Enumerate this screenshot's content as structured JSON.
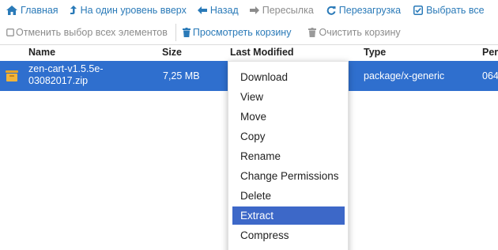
{
  "toolbar": {
    "home": "Главная",
    "up": "На один уровень вверх",
    "back": "Назад",
    "forward": "Пересылка",
    "reload": "Перезагрузка",
    "select_all": "Выбрать все",
    "deselect_all": "Отменить выбор всех элементов",
    "view_trash": "Просмотреть корзину",
    "empty_trash": "Очистить корзину"
  },
  "table": {
    "columns": [
      "Name",
      "Size",
      "Last Modified",
      "Type",
      "Per"
    ],
    "rows": [
      {
        "name_line1": "zen-cart-v1.5.5e-",
        "name_line2": "03082017.zip",
        "size": "7,25 MB",
        "type": "package/x-generic",
        "perms": "064"
      }
    ]
  },
  "context_menu": {
    "items": [
      "Download",
      "View",
      "Move",
      "Copy",
      "Rename",
      "Change Permissions",
      "Delete",
      "Extract",
      "Compress"
    ],
    "highlighted": "Extract"
  },
  "colors": {
    "link": "#2a7ab8",
    "selected_row": "#2f6fce",
    "menu_highlight": "#3d68c8",
    "archive_icon": "#e8a624"
  },
  "icons": [
    "home-icon",
    "level-up-icon",
    "arrow-left-icon",
    "arrow-right-icon",
    "refresh-icon",
    "checkbox-checked-icon",
    "checkbox-empty-icon",
    "trash-icon",
    "trash-icon-disabled",
    "archive-icon"
  ]
}
